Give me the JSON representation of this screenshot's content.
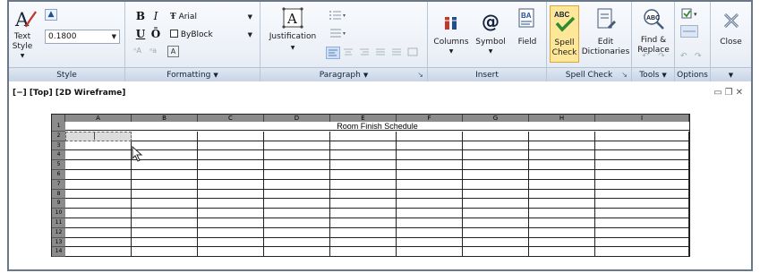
{
  "ribbon": {
    "style": {
      "title": "Style",
      "text_style_label": "Text Style",
      "text_style_arrow": "▼",
      "text_height_value": "0.1800"
    },
    "formatting": {
      "title": "Formatting",
      "bold": "B",
      "italic": "I",
      "underline": "U",
      "overline": "Ō",
      "font_value": "Arial",
      "color_value": "ByBlock"
    },
    "paragraph": {
      "title": "Paragraph",
      "justification_label": "Justification"
    },
    "insert": {
      "title": "Insert",
      "columns_label": "Columns",
      "symbol_label": "Symbol",
      "field_label": "Field"
    },
    "spell_check": {
      "title": "Spell Check",
      "spell_check_label": "Spell Check",
      "edit_dictionaries_label": "Edit Dictionaries"
    },
    "tools": {
      "title": "Tools",
      "find_replace_label": "Find & Replace"
    },
    "options": {
      "title": "Options"
    },
    "close": {
      "label": "Close"
    }
  },
  "viewport": {
    "label": "[−] [Top] [2D Wireframe]"
  },
  "table": {
    "title": "Room Finish Schedule",
    "active_cell_text": "|",
    "columns": [
      "A",
      "B",
      "C",
      "D",
      "E",
      "F",
      "G",
      "H",
      "I"
    ],
    "rows": [
      "1",
      "2",
      "3",
      "4",
      "5",
      "6",
      "7",
      "8",
      "9",
      "10",
      "11",
      "12",
      "13",
      "14"
    ]
  }
}
